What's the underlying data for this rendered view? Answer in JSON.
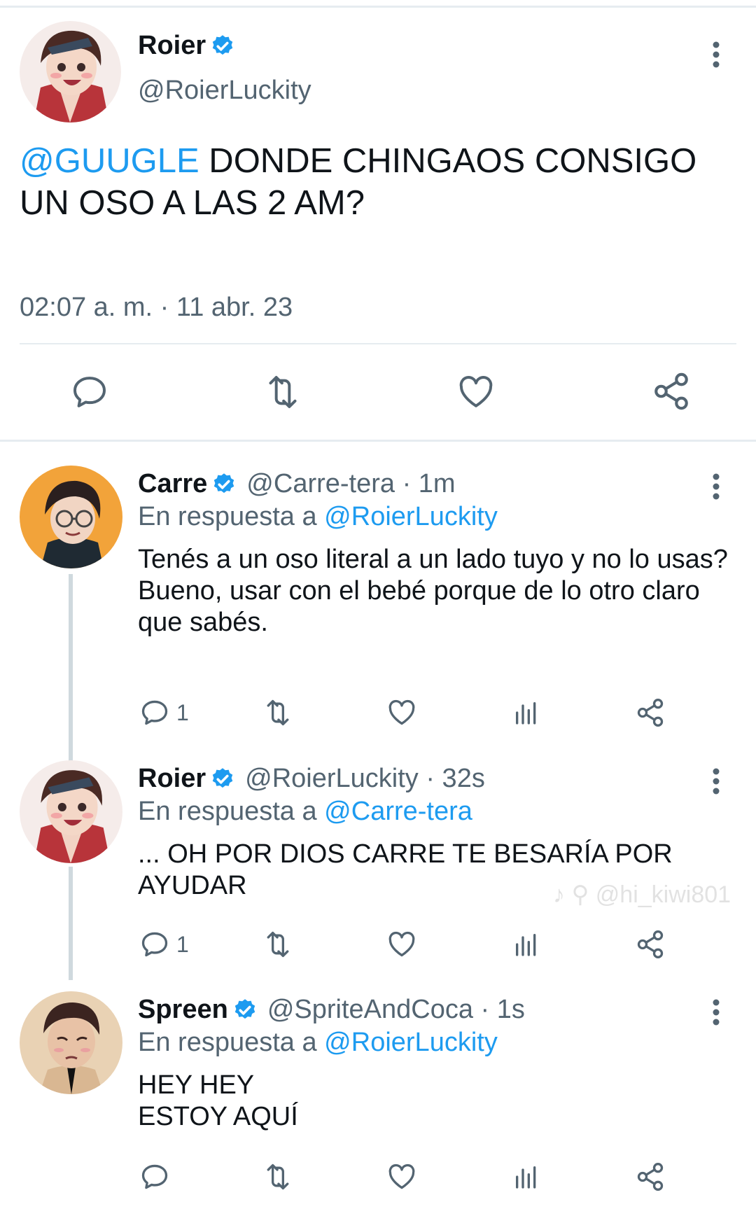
{
  "main_tweet": {
    "author_name": "Roier",
    "author_handle": "@RoierLuckity",
    "text_mention": "@GUUGLE",
    "text_body": " DONDE CHINGAOS CONSIGO UN OSO A LAS 2 AM?",
    "timestamp": "02:07 a. m. · 11 abr. 23",
    "actions": [
      "reply-icon",
      "retweet-icon",
      "like-icon",
      "share-icon"
    ]
  },
  "replies": [
    {
      "author_name": "Carre",
      "author_handle": "@Carre-tera · 1m",
      "reply_to_prefix": "En respuesta a ",
      "reply_to_handle": "@RoierLuckity",
      "text_line1": "Tenés a un oso literal a un lado tuyo y no lo usas?",
      "text_line2": "Bueno, usar con el bebé porque de lo otro claro que sabés.",
      "reply_count": "1"
    },
    {
      "author_name": "Roier",
      "author_handle": "@RoierLuckity · 32s",
      "reply_to_prefix": "En respuesta a ",
      "reply_to_handle": "@Carre-tera",
      "text_line1": "... OH POR DIOS CARRE TE BESARÍA POR AYUDAR",
      "text_line2": "",
      "reply_count": "1"
    },
    {
      "author_name": "Spreen",
      "author_handle": "@SpriteAndCoca · 1s",
      "reply_to_prefix": "En respuesta a ",
      "reply_to_handle": "@RoierLuckity",
      "text_line1": "HEY HEY",
      "text_line2": "ESTOY AQUÍ",
      "reply_count": ""
    }
  ],
  "watermark": "♪ ⚲ @hi_kiwi801",
  "colors": {
    "accent": "#1d9bf0",
    "secondary_text": "#536471",
    "primary_text": "#0f1419",
    "icon_gray": "#536471",
    "verified_badge": "#1d9bf0"
  },
  "icons": [
    "verified-badge-icon",
    "more-options-icon",
    "reply-icon",
    "retweet-icon",
    "like-icon",
    "views-icon",
    "share-icon"
  ]
}
